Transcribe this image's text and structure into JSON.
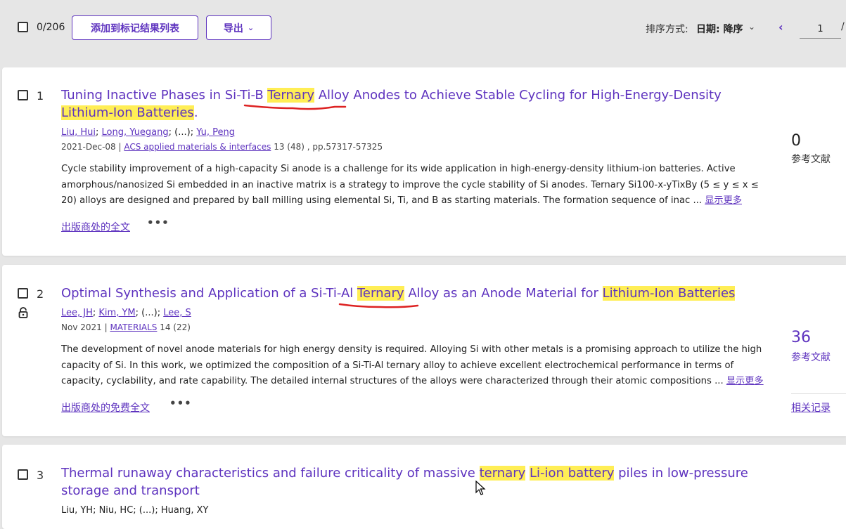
{
  "toolbar": {
    "count": "0/206",
    "add_marked": "添加到标记结果列表",
    "export": "导出",
    "sort_label": "排序方式:",
    "sort_value": "日期: 降序",
    "page_value": "1",
    "page_slash": "/"
  },
  "records": [
    {
      "num": "1",
      "title_parts": [
        "Tuning Inactive Phases in Si-Ti-B ",
        "Ternary",
        " Alloy Anodes to Achieve Stable Cycling for High-Energy-Density ",
        "Lithium-Ion Batteries",
        "."
      ],
      "authors": [
        "Liu, Hui",
        "Long, Yuegang",
        "(...)",
        "Yu, Peng"
      ],
      "date": "2021-Dec-08",
      "journal": "ACS applied materials & interfaces",
      "volume": "13 (48) , pp.57317-57325",
      "abstract": "Cycle stability improvement of a high-capacity Si anode is a challenge for its wide application in high-energy-density lithium-ion batteries. Active amorphous/nanosized Si embedded in an inactive matrix is a strategy to improve the cycle stability of Si anodes. Ternary Si100-x-yTixBy (5 ≤ y ≤ x ≤ 20) alloys are designed and prepared by ball milling using elemental Si, Ti, and B as starting materials. The formation sequence of inac ...",
      "show_more": "显示更多",
      "fulltext": "出版商处的全文",
      "dots": "•••",
      "refs": "0",
      "refs_label": "参考文献"
    },
    {
      "num": "2",
      "title_parts": [
        "Optimal Synthesis and Application of a Si-Ti-Al ",
        "Ternary",
        " Alloy as an Anode Material for ",
        "Lithium-Ion Batteries",
        ""
      ],
      "authors": [
        "Lee, JH",
        "Kim, YM",
        "(...)",
        "Lee, S"
      ],
      "date": "Nov 2021",
      "journal": "MATERIALS",
      "volume": "14 (22)",
      "abstract": "The development of novel anode materials for high energy density is required. Alloying Si with other metals is a promising approach to utilize the high capacity of Si. In this work, we optimized the composition of a Si-Ti-Al ternary alloy to achieve excellent electrochemical performance in terms of capacity, cyclability, and rate capability. The detailed internal structures of the alloys were characterized through their atomic compositions ...",
      "show_more": "显示更多",
      "fulltext": "出版商处的免费全文",
      "dots": "•••",
      "refs": "36",
      "refs_label": "参考文献",
      "related": "相关记录"
    },
    {
      "num": "3",
      "title_parts": [
        "Thermal runaway characteristics and failure criticality of massive ",
        "ternary",
        " ",
        "Li-ion battery",
        " piles in low-pressure storage and transport"
      ],
      "authors_text": "Liu, YH; Niu, HC; (...); Huang, XY"
    }
  ]
}
